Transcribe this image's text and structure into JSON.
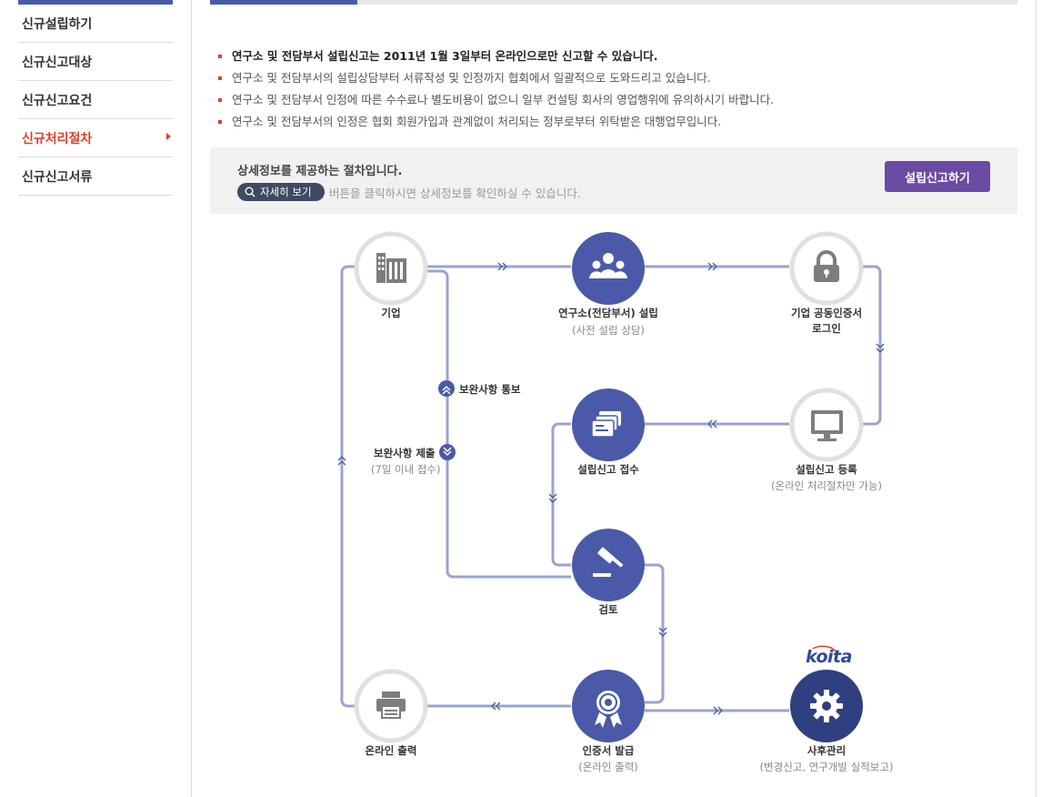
{
  "sidebar": {
    "items": [
      {
        "label": "신규설립하기",
        "active": false
      },
      {
        "label": "신규신고대상",
        "active": false
      },
      {
        "label": "신규신고요건",
        "active": false
      },
      {
        "label": "신규처리절차",
        "active": true
      },
      {
        "label": "신규신고서류",
        "active": false
      }
    ]
  },
  "notices": [
    "연구소 및 전담부서 설립신고는 2011년 1월 3일부터 온라인으로만 신고할 수 있습니다.",
    "연구소 및 전담부서의 설립상담부터 서류작성 및 인정까지 협회에서 일괄적으로 도와드리고 있습니다.",
    "연구소 및 전담부서 인정에 따른 수수료나 별도비용이 없으니 일부 컨설팅 회사의 영업행위에 유의하시기 바랍니다.",
    "연구소 및 전담부서의 인정은 협회 회원가입과 관계없이 처리되는 정부로부터 위탁받은 대행업무입니다."
  ],
  "infobox": {
    "title": "상세정보를 제공하는 절차입니다.",
    "detail_button": "자세히 보기",
    "hint": "버튼을 클릭하시면 상세정보를 확인하실 수 있습니다.",
    "apply_button": "설립신고하기"
  },
  "flow": {
    "company": {
      "label": "기업"
    },
    "establish": {
      "label": "연구소(전담부서) 설립",
      "sub": "(사전 설립 상담)"
    },
    "cert_login": {
      "label1": "기업 공동인증서",
      "label2": "로그인"
    },
    "register": {
      "label": "설립신고 등록",
      "sub": "(온라인 처리절차만 가능)"
    },
    "receipt": {
      "label": "설립신고 접수"
    },
    "review": {
      "label": "검토"
    },
    "supplement_notice": {
      "label": "보완사항 통보"
    },
    "supplement_submit": {
      "label": "보완사항 제출",
      "sub": "(7일 이내 접수)"
    },
    "print": {
      "label": "온라인 출력"
    },
    "issue": {
      "label": "인증서 발급",
      "sub": "(온라인 출력)"
    },
    "aftercare": {
      "label": "사후관리",
      "sub": "(변경신고, 연구개발 실적보고)"
    },
    "logo_text": "koita"
  },
  "colors": {
    "accent": "#4a5aa8",
    "active_red": "#d9432d",
    "line": "#9aa3cf",
    "node_blue": "#4a5aa8",
    "node_dark": "#2f3f80",
    "node_gray_ring": "#e0e0e0",
    "apply_purple": "#6b4aa3"
  },
  "icons": [
    "building-icon",
    "people-icon",
    "lock-icon",
    "monitor-icon",
    "files-icon",
    "gavel-icon",
    "printer-icon",
    "medal-icon",
    "gear-icon",
    "search-icon",
    "chevron-up-icon",
    "chevron-down-icon"
  ]
}
